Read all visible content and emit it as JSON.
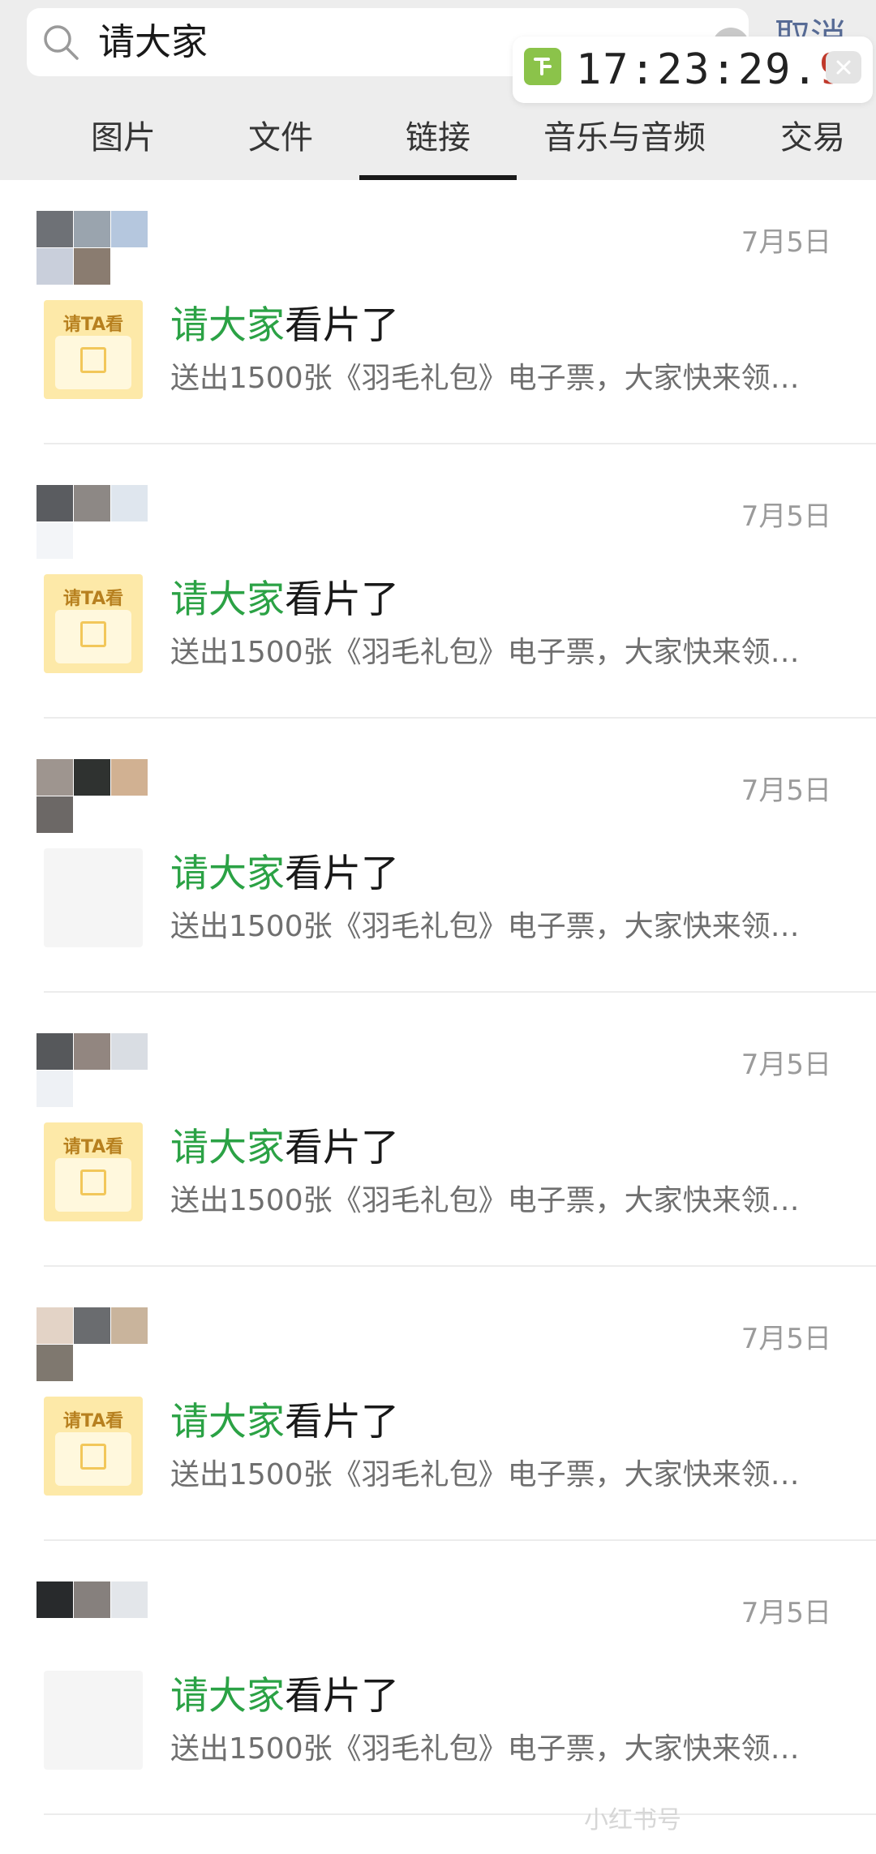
{
  "search": {
    "query": "请大家",
    "cancel_label": "取消"
  },
  "clock": {
    "time_main": "17:23:29.",
    "time_tenths": "9",
    "close_label": "×"
  },
  "tabs": [
    {
      "label": "图片",
      "selected": false
    },
    {
      "label": "文件",
      "selected": false
    },
    {
      "label": "链接",
      "selected": true
    },
    {
      "label": "音乐与音频",
      "selected": false
    },
    {
      "label": "交易",
      "selected": false
    }
  ],
  "results": [
    {
      "date": "7月5日",
      "title_highlight": "请大家",
      "title_rest": "看片了",
      "desc": "送出1500张《羽毛礼包》电子票，大家快来领…",
      "thumb": "gift",
      "thumb_label": "请TA看"
    },
    {
      "date": "7月5日",
      "title_highlight": "请大家",
      "title_rest": "看片了",
      "desc": "送出1500张《羽毛礼包》电子票，大家快来领…",
      "thumb": "gift",
      "thumb_label": "请TA看"
    },
    {
      "date": "7月5日",
      "title_highlight": "请大家",
      "title_rest": "看片了",
      "desc": "送出1500张《羽毛礼包》电子票，大家快来领…",
      "thumb": "blank",
      "thumb_label": ""
    },
    {
      "date": "7月5日",
      "title_highlight": "请大家",
      "title_rest": "看片了",
      "desc": "送出1500张《羽毛礼包》电子票，大家快来领…",
      "thumb": "gift",
      "thumb_label": "请TA看"
    },
    {
      "date": "7月5日",
      "title_highlight": "请大家",
      "title_rest": "看片了",
      "desc": "送出1500张《羽毛礼包》电子票，大家快来领…",
      "thumb": "gift",
      "thumb_label": "请TA看"
    },
    {
      "date": "7月5日",
      "title_highlight": "请大家",
      "title_rest": "看片了",
      "desc": "送出1500张《羽毛礼包》电子票，大家快来领…",
      "thumb": "blank",
      "thumb_label": ""
    }
  ],
  "avatar_palettes": [
    [
      "#6e7176",
      "#9aa4ae",
      "#b5c7de",
      "#c9cfdb",
      "#8a7c70"
    ],
    [
      "#5a5c60",
      "#8d8885",
      "#dfe6ee",
      "#f3f5f8"
    ],
    [
      "#9e958f",
      "#2f3230",
      "#d1b192",
      "#6c6866"
    ],
    [
      "#56585b",
      "#928680",
      "#d9dde3",
      "#eef1f5"
    ],
    [
      "#e3d3c6",
      "#6a6c6f",
      "#c9b49c",
      "#7f786f"
    ],
    [
      "#282a2c",
      "#86807d",
      "#e3e6ea"
    ]
  ],
  "colors": {
    "highlight": "#2ba245",
    "header_bg": "#ededed",
    "date": "#9b9b9b"
  },
  "watermark": "小红书号"
}
